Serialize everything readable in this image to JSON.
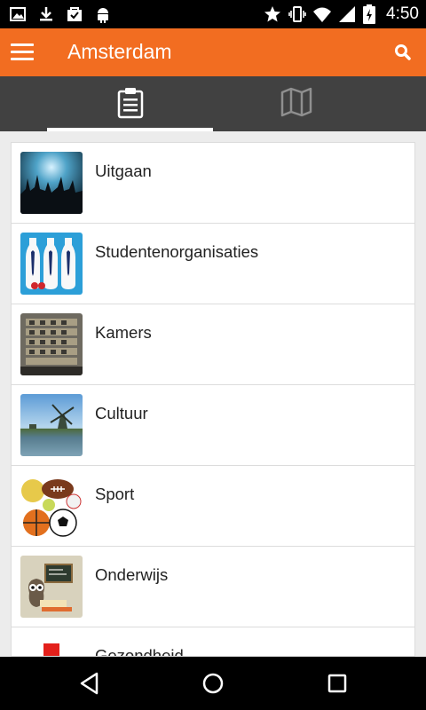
{
  "status_bar": {
    "clock": "4:50",
    "icons": [
      "image-notification-icon",
      "download-icon",
      "shopping-bag-icon",
      "android-icon",
      "star-icon",
      "vibrate-icon",
      "wifi-icon",
      "signal-icon",
      "battery-icon"
    ]
  },
  "app_bar": {
    "title": "Amsterdam",
    "menu_icon": "hamburger-menu-icon",
    "search_icon": "search-icon",
    "color": "#f26d21"
  },
  "tabs": [
    {
      "icon": "clipboard-list-icon",
      "selected": true
    },
    {
      "icon": "map-icon",
      "selected": false
    }
  ],
  "list": {
    "items": [
      {
        "label": "Uitgaan",
        "thumbnail": "concert-crowd-photo"
      },
      {
        "label": "Studentenorganisaties",
        "thumbnail": "bowling-pins-with-ties-photo"
      },
      {
        "label": "Kamers",
        "thumbnail": "student-housing-containers-photo"
      },
      {
        "label": "Cultuur",
        "thumbnail": "windmill-photo"
      },
      {
        "label": "Sport",
        "thumbnail": "sports-balls-photo"
      },
      {
        "label": "Onderwijs",
        "thumbnail": "study-owl-chalkboard-photo"
      },
      {
        "label": "Gezondheid",
        "thumbnail": "red-cross-photo"
      }
    ]
  },
  "nav_bar": {
    "buttons": [
      "back-icon",
      "home-icon",
      "recents-icon"
    ]
  }
}
